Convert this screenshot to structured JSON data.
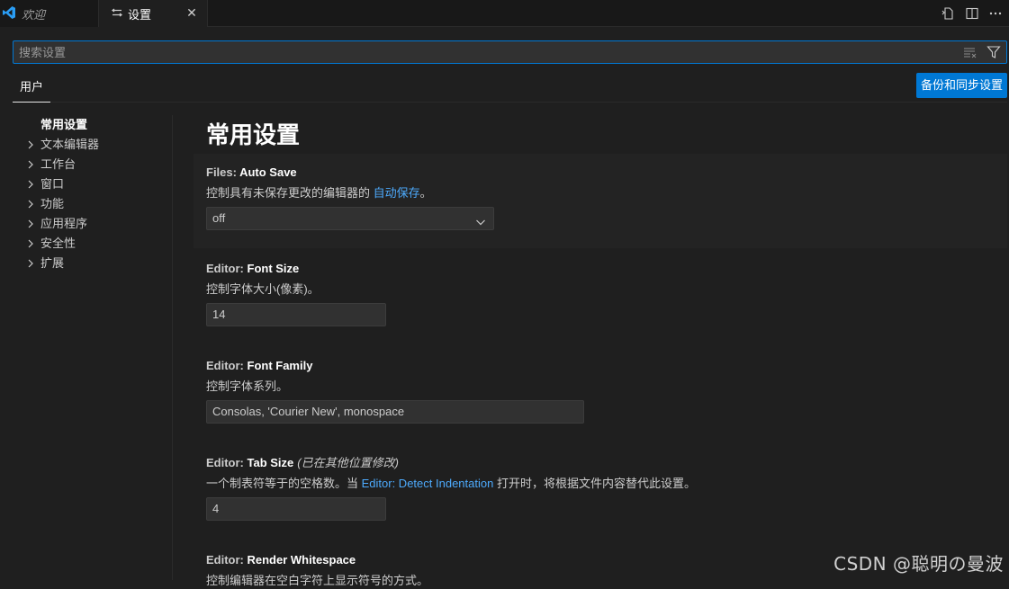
{
  "tabs": [
    {
      "label": "欢迎",
      "icon": "vscode-logo-icon"
    },
    {
      "label": "设置",
      "icon": "settings-sliders-icon",
      "close": "✕"
    }
  ],
  "search": {
    "placeholder": "搜索设置",
    "value": ""
  },
  "scope_tabs": [
    {
      "label": "用户"
    }
  ],
  "sync_button": "备份和同步设置",
  "toc": [
    {
      "label": "常用设置",
      "active": true
    },
    {
      "label": "文本编辑器"
    },
    {
      "label": "工作台"
    },
    {
      "label": "窗口"
    },
    {
      "label": "功能"
    },
    {
      "label": "应用程序"
    },
    {
      "label": "安全性"
    },
    {
      "label": "扩展"
    }
  ],
  "section_title": "常用设置",
  "settings": [
    {
      "category": "Files: ",
      "name": "Auto Save",
      "desc_before": "控制具有未保存更改的编辑器的 ",
      "desc_link": "自动保存",
      "desc_after": "。",
      "value": "off"
    },
    {
      "category": "Editor: ",
      "name": "Font Size",
      "desc": "控制字体大小(像素)。",
      "value": "14"
    },
    {
      "category": "Editor: ",
      "name": "Font Family",
      "desc": "控制字体系列。",
      "value": "Consolas, 'Courier New', monospace"
    },
    {
      "category": "Editor: ",
      "name": "Tab Size",
      "modified": "(已在其他位置修改)",
      "desc_before": "一个制表符等于的空格数。当 ",
      "desc_link": "Editor: Detect Indentation",
      "desc_after": " 打开时，将根据文件内容替代此设置。",
      "value": "4"
    },
    {
      "category": "Editor: ",
      "name": "Render Whitespace",
      "desc": "控制编辑器在空白字符上显示符号的方式。"
    }
  ],
  "watermark": "CSDN @聪明の曼波",
  "colors": {
    "accent": "#0078d4",
    "link": "#4daafc",
    "background": "#1f1f1f"
  }
}
